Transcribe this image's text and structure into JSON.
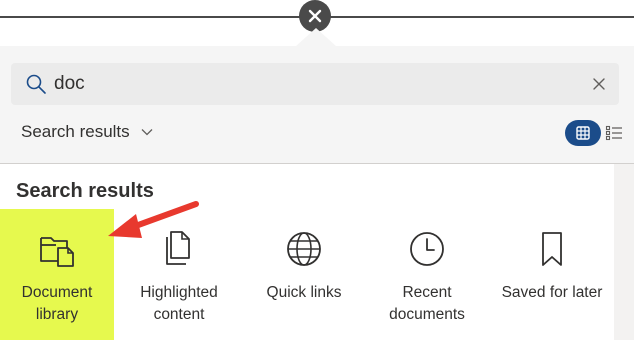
{
  "search": {
    "value": "doc",
    "placeholder": ""
  },
  "filter": {
    "label": "Search results"
  },
  "section": {
    "title": "Search results"
  },
  "tiles": [
    {
      "label_line1": "Document",
      "label_line2": "library",
      "icon": "folder-document-icon"
    },
    {
      "label_line1": "Highlighted",
      "label_line2": "content",
      "icon": "documents-stack-icon"
    },
    {
      "label_line1": "Quick links",
      "label_line2": "",
      "icon": "globe-icon"
    },
    {
      "label_line1": "Recent",
      "label_line2": "documents",
      "icon": "clock-icon"
    },
    {
      "label_line1": "Saved for later",
      "label_line2": "",
      "icon": "bookmark-icon"
    }
  ],
  "colors": {
    "highlight": "#e6f94e",
    "toggle_active": "#1b4c8a",
    "arrow": "#e8392e"
  }
}
